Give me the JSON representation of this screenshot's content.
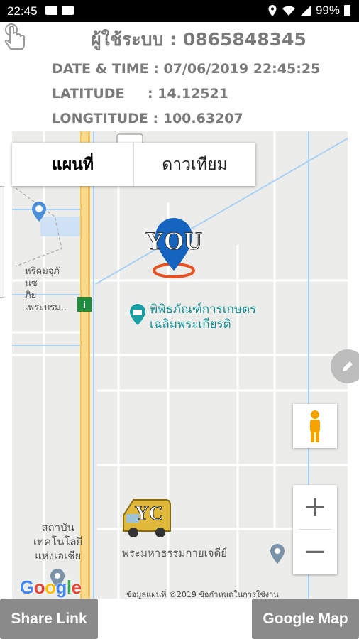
{
  "status_bar": {
    "time": "22:45",
    "battery": "99%"
  },
  "header": {
    "user_line": "ผู้ใช้ระบบ : 0865848345",
    "datetime_label": "DATE & TIME : 07/06/2019 22:45:25",
    "latitude_label": "LATITUDE",
    "latitude_value": ": 14.12521",
    "longitude_label": "LONGTITUDE : 100.63207"
  },
  "map": {
    "type_options": [
      "แผนที่",
      "ดาวเทียม"
    ],
    "selected_type": "แผนที่",
    "poi_museum_line1": "พิพิธภัณฑ์การเกษตร",
    "poi_museum_line2": "เฉลิมพระเกียรติ",
    "poi_temple": "พระมหาธรรมกายเจดีย์",
    "poi_institute_line1": "สถาบัน",
    "poi_institute_line2": "เทคโนโลยี",
    "poi_institute_line3": "แห่งเอเชีย",
    "topleft_line1": "หริคมจุภั",
    "topleft_line2": "นซ",
    "topleft_line3": "ภิย",
    "topleft_line4": "เพระบรม..",
    "you_marker_text": "YOU",
    "yc_marker_text": "YC",
    "route_badge": "i",
    "copyright": "ข้อมูลแผนที่ ©2019    ข้อกำหนดในการใช้งาน",
    "google_logo": "Google",
    "zoom_in": "+",
    "zoom_out": "−",
    "colors": {
      "road_major": "#f6c65b",
      "road_minor": "#ffffff",
      "water": "#a9d0f5",
      "marker_blue": "#1565c0",
      "marker_orange": "#e6501e"
    }
  },
  "buttons": {
    "share_link": "Share Link",
    "google_map": "Google Map"
  }
}
